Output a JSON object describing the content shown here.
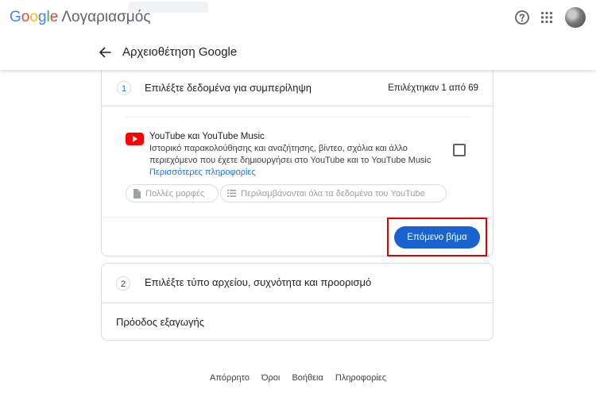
{
  "topbar": {
    "brand_letters": [
      {
        "ch": "G",
        "color": "#4285F4"
      },
      {
        "ch": "o",
        "color": "#EA4335"
      },
      {
        "ch": "o",
        "color": "#FBBC05"
      },
      {
        "ch": "g",
        "color": "#4285F4"
      },
      {
        "ch": "l",
        "color": "#34A853"
      },
      {
        "ch": "e",
        "color": "#EA4335"
      }
    ],
    "account_label": "Λογαριασμός",
    "icons": [
      "help-icon",
      "apps-grid-icon",
      "avatar"
    ]
  },
  "subheader": {
    "back_icon": "arrow-back-icon",
    "title": "Αρχειοθέτηση Google"
  },
  "step1": {
    "number": "1",
    "title": "Επιλέξτε δεδομένα για συμπερίληψη",
    "selected_count": "Επιλέχτηκαν 1 από 69",
    "product": {
      "icon": "youtube-icon",
      "name": "YouTube και YouTube Music",
      "description": "Ιστορικό παρακολούθησης και αναζήτησης, βίντεο, σχόλια και άλλο περιεχόμενο που έχετε δημιουργήσει στο YouTube και το YouTube Music",
      "more_link": "Περισσότερες πληροφορίες",
      "checked": false
    },
    "chips": [
      {
        "icon": "file-icon",
        "label": "Πολλές μορφές"
      },
      {
        "icon": "list-icon",
        "label": "Περιλαμβάνονται όλα τα δεδομένα του YouTube"
      }
    ],
    "next_button": "Επόμενο βήμα",
    "highlight_color": "#e00000"
  },
  "step2": {
    "number": "2",
    "title": "Επιλέξτε τύπο αρχείου, συχνότητα και προορισμό"
  },
  "progress_label": "Πρόοδος εξαγωγής",
  "footer": {
    "links": [
      "Απόρρητο",
      "Όροι",
      "Βοήθεια",
      "Πληροφορίες"
    ]
  },
  "colors": {
    "accent": "#1a73e8",
    "button": "#1a62cf",
    "youtube": "#ff0000"
  }
}
